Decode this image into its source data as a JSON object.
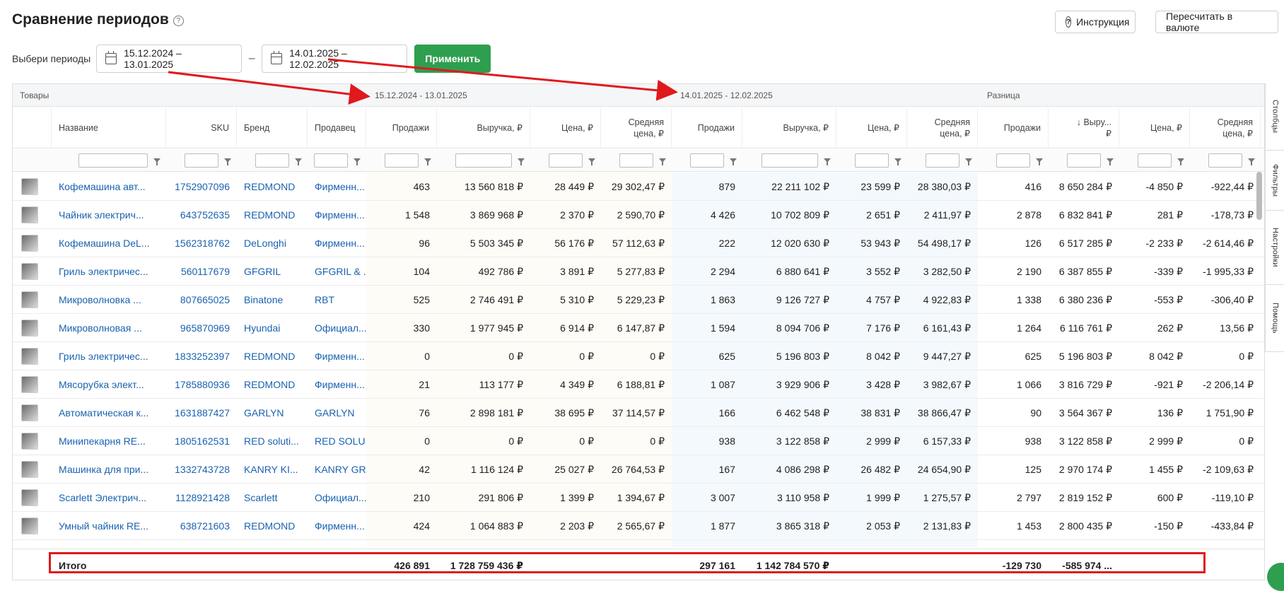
{
  "page": {
    "title": "Сравнение периодов",
    "instruction_button": "Инструкция",
    "recalc_button": "Пересчитать в валюте",
    "period_label": "Выбери периоды",
    "period1": "15.12.2024 – 13.01.2025",
    "period_sep": "–",
    "period2": "14.01.2025 – 12.02.2025",
    "apply_button": "Применить"
  },
  "groups": {
    "goods": "Товары",
    "p1": "15.12.2024 - 13.01.2025",
    "p2": "14.01.2025 - 12.02.2025",
    "diff": "Разница"
  },
  "columns": {
    "name": "Название",
    "sku": "SKU",
    "brand": "Бренд",
    "seller": "Продавец",
    "sales": "Продажи",
    "revenue": "Выручка, ₽",
    "price": "Цена, ₽",
    "avg_price_1": "Средняя",
    "avg_price_2": "цена, ₽",
    "diff_revenue_1": "↓ Выру...",
    "diff_revenue_2": "₽"
  },
  "rows": [
    {
      "name": "Кофемашина авт...",
      "sku": "1752907096",
      "brand": "REDMOND",
      "seller": "Фирменн...",
      "s1": "463",
      "r1": "13 560 818 ₽",
      "pr1": "28 449 ₽",
      "a1": "29 302,47 ₽",
      "s2": "879",
      "r2": "22 211 102 ₽",
      "pr2": "23 599 ₽",
      "a2": "28 380,03 ₽",
      "ds": "416",
      "dr": "8 650 284 ₽",
      "dp": "-4 850 ₽",
      "da": "-922,44 ₽"
    },
    {
      "name": "Чайник электрич...",
      "sku": "643752635",
      "brand": "REDMOND",
      "seller": "Фирменн...",
      "s1": "1 548",
      "r1": "3 869 968 ₽",
      "pr1": "2 370 ₽",
      "a1": "2 590,70 ₽",
      "s2": "4 426",
      "r2": "10 702 809 ₽",
      "pr2": "2 651 ₽",
      "a2": "2 411,97 ₽",
      "ds": "2 878",
      "dr": "6 832 841 ₽",
      "dp": "281 ₽",
      "da": "-178,73 ₽"
    },
    {
      "name": "Кофемашина DeL...",
      "sku": "1562318762",
      "brand": "DeLonghi",
      "seller": "Фирменн...",
      "s1": "96",
      "r1": "5 503 345 ₽",
      "pr1": "56 176 ₽",
      "a1": "57 112,63 ₽",
      "s2": "222",
      "r2": "12 020 630 ₽",
      "pr2": "53 943 ₽",
      "a2": "54 498,17 ₽",
      "ds": "126",
      "dr": "6 517 285 ₽",
      "dp": "-2 233 ₽",
      "da": "-2 614,46 ₽"
    },
    {
      "name": "Гриль электричес...",
      "sku": "560117679",
      "brand": "GFGRIL",
      "seller": "GFGRIL & ...",
      "s1": "104",
      "r1": "492 786 ₽",
      "pr1": "3 891 ₽",
      "a1": "5 277,83 ₽",
      "s2": "2 294",
      "r2": "6 880 641 ₽",
      "pr2": "3 552 ₽",
      "a2": "3 282,50 ₽",
      "ds": "2 190",
      "dr": "6 387 855 ₽",
      "dp": "-339 ₽",
      "da": "-1 995,33 ₽"
    },
    {
      "name": "Микроволновка ...",
      "sku": "807665025",
      "brand": "Binatone",
      "seller": "RBT",
      "s1": "525",
      "r1": "2 746 491 ₽",
      "pr1": "5 310 ₽",
      "a1": "5 229,23 ₽",
      "s2": "1 863",
      "r2": "9 126 727 ₽",
      "pr2": "4 757 ₽",
      "a2": "4 922,83 ₽",
      "ds": "1 338",
      "dr": "6 380 236 ₽",
      "dp": "-553 ₽",
      "da": "-306,40 ₽"
    },
    {
      "name": "Микроволновая ...",
      "sku": "965870969",
      "brand": "Hyundai",
      "seller": "Официал...",
      "s1": "330",
      "r1": "1 977 945 ₽",
      "pr1": "6 914 ₽",
      "a1": "6 147,87 ₽",
      "s2": "1 594",
      "r2": "8 094 706 ₽",
      "pr2": "7 176 ₽",
      "a2": "6 161,43 ₽",
      "ds": "1 264",
      "dr": "6 116 761 ₽",
      "dp": "262 ₽",
      "da": "13,56 ₽"
    },
    {
      "name": "Гриль электричес...",
      "sku": "1833252397",
      "brand": "REDMOND",
      "seller": "Фирменн...",
      "s1": "0",
      "r1": "0 ₽",
      "pr1": "0 ₽",
      "a1": "0 ₽",
      "s2": "625",
      "r2": "5 196 803 ₽",
      "pr2": "8 042 ₽",
      "a2": "9 447,27 ₽",
      "ds": "625",
      "dr": "5 196 803 ₽",
      "dp": "8 042 ₽",
      "da": "0 ₽"
    },
    {
      "name": "Мясорубка элект...",
      "sku": "1785880936",
      "brand": "REDMOND",
      "seller": "Фирменн...",
      "s1": "21",
      "r1": "113 177 ₽",
      "pr1": "4 349 ₽",
      "a1": "6 188,81 ₽",
      "s2": "1 087",
      "r2": "3 929 906 ₽",
      "pr2": "3 428 ₽",
      "a2": "3 982,67 ₽",
      "ds": "1 066",
      "dr": "3 816 729 ₽",
      "dp": "-921 ₽",
      "da": "-2 206,14 ₽"
    },
    {
      "name": "Автоматическая к...",
      "sku": "1631887427",
      "brand": "GARLYN",
      "seller": "GARLYN",
      "s1": "76",
      "r1": "2 898 181 ₽",
      "pr1": "38 695 ₽",
      "a1": "37 114,57 ₽",
      "s2": "166",
      "r2": "6 462 548 ₽",
      "pr2": "38 831 ₽",
      "a2": "38 866,47 ₽",
      "ds": "90",
      "dr": "3 564 367 ₽",
      "dp": "136 ₽",
      "da": "1 751,90 ₽"
    },
    {
      "name": "Минипекарня RE...",
      "sku": "1805162531",
      "brand": "RED soluti...",
      "seller": "RED SOLU...",
      "s1": "0",
      "r1": "0 ₽",
      "pr1": "0 ₽",
      "a1": "0 ₽",
      "s2": "938",
      "r2": "3 122 858 ₽",
      "pr2": "2 999 ₽",
      "a2": "6 157,33 ₽",
      "ds": "938",
      "dr": "3 122 858 ₽",
      "dp": "2 999 ₽",
      "da": "0 ₽"
    },
    {
      "name": "Машинка для при...",
      "sku": "1332743728",
      "brand": "KANRY KI...",
      "seller": "KANRY GR...",
      "s1": "42",
      "r1": "1 116 124 ₽",
      "pr1": "25 027 ₽",
      "a1": "26 764,53 ₽",
      "s2": "167",
      "r2": "4 086 298 ₽",
      "pr2": "26 482 ₽",
      "a2": "24 654,90 ₽",
      "ds": "125",
      "dr": "2 970 174 ₽",
      "dp": "1 455 ₽",
      "da": "-2 109,63 ₽"
    },
    {
      "name": "Scarlett Электрич...",
      "sku": "1128921428",
      "brand": "Scarlett",
      "seller": "Официал...",
      "s1": "210",
      "r1": "291 806 ₽",
      "pr1": "1 399 ₽",
      "a1": "1 394,67 ₽",
      "s2": "3 007",
      "r2": "3 110 958 ₽",
      "pr2": "1 999 ₽",
      "a2": "1 275,57 ₽",
      "ds": "2 797",
      "dr": "2 819 152 ₽",
      "dp": "600 ₽",
      "da": "-119,10 ₽"
    },
    {
      "name": "Умный чайник RE...",
      "sku": "638721603",
      "brand": "REDMOND",
      "seller": "Фирменн...",
      "s1": "424",
      "r1": "1 064 883 ₽",
      "pr1": "2 203 ₽",
      "a1": "2 565,67 ₽",
      "s2": "1 877",
      "r2": "3 865 318 ₽",
      "pr2": "2 053 ₽",
      "a2": "2 131,83 ₽",
      "ds": "1 453",
      "dr": "2 800 435 ₽",
      "dp": "-150 ₽",
      "da": "-433,84 ₽"
    }
  ],
  "total": {
    "label": "Итого",
    "s1": "426 891",
    "r1": "1 728 759 436 ₽",
    "s2": "297 161",
    "r2": "1 142 784 570 ₽",
    "ds": "-129 730",
    "dr": "-585 974 ..."
  },
  "side_tabs": [
    "Столбцы",
    "Фильтры",
    "Настройки",
    "Помощь"
  ]
}
